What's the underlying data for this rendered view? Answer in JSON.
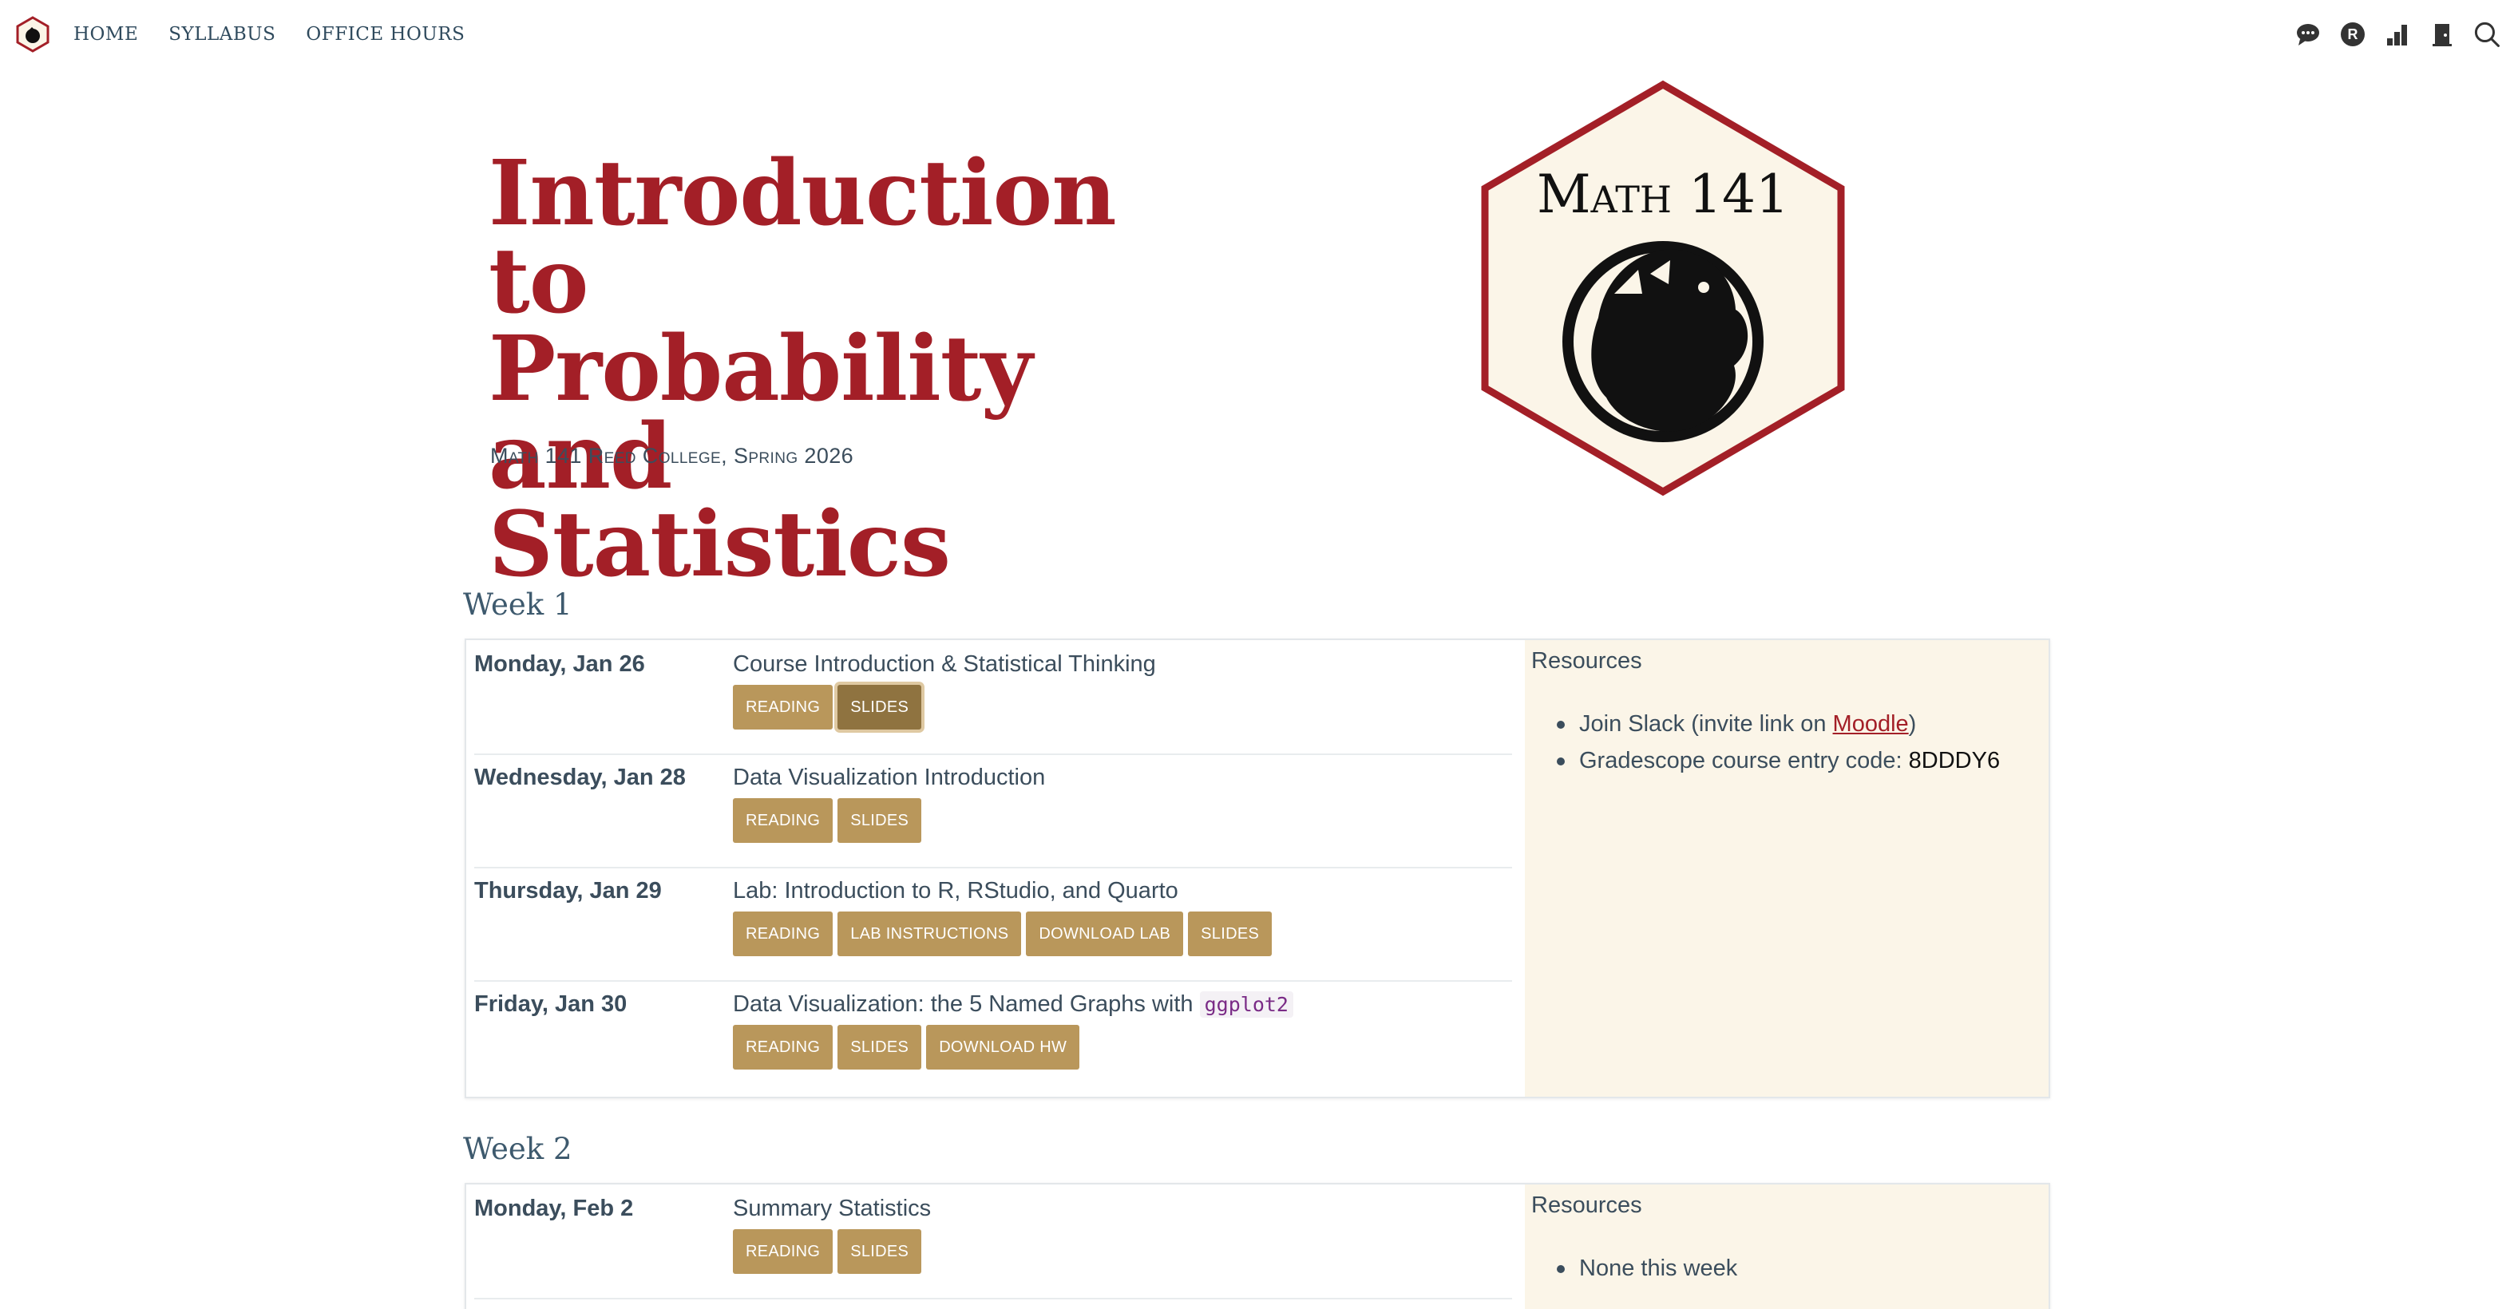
{
  "nav": {
    "logo_icon": "reed-griffin-hex-icon",
    "links": [
      "HOME",
      "SYLLABUS",
      "OFFICE HOURS"
    ],
    "icons": [
      "chat-bubble-icon",
      "r-circle-icon",
      "bar-chart-icon",
      "door-icon",
      "search-icon"
    ]
  },
  "hero": {
    "title_lines": [
      "Introduction to",
      "Probability and",
      "Statistics"
    ],
    "subtitle": "Math 141 Reed College, Spring 2026",
    "logo_text": "Math 141",
    "logo_icon": "griffin-emblem-icon"
  },
  "colors": {
    "accent": "#a31f27",
    "button": "#b9975b",
    "button_active": "#8f7340",
    "resources_bg": "#fbf5e8"
  },
  "weeks": [
    {
      "title": "Week 1",
      "sessions": [
        {
          "date": "Monday, Jan 26",
          "title": "Course Introduction & Statistical Thinking",
          "buttons": [
            "READING",
            "SLIDES"
          ]
        },
        {
          "date": "Wednesday, Jan 28",
          "title": "Data Visualization Introduction",
          "buttons": [
            "READING",
            "SLIDES"
          ]
        },
        {
          "date": "Thursday, Jan 29",
          "title": "Lab: Introduction to R, RStudio, and Quarto",
          "buttons": [
            "READING",
            "LAB INSTRUCTIONS",
            "DOWNLOAD LAB",
            "SLIDES"
          ]
        },
        {
          "date": "Friday, Jan 30",
          "title": "Data Visualization: the 5 Named Graphs with",
          "title_code": "ggplot2",
          "buttons": [
            "READING",
            "SLIDES",
            "DOWNLOAD HW"
          ]
        }
      ],
      "resources": {
        "title": "Resources",
        "items": [
          {
            "prefix": "Join Slack (invite link on ",
            "link": "Moodle",
            "suffix": ")"
          },
          {
            "prefix": "Gradescope course entry code: ",
            "code": "8DDDY6"
          }
        ]
      }
    },
    {
      "title": "Week 2",
      "sessions": [
        {
          "date": "Monday, Feb 2",
          "title": "Summary Statistics",
          "buttons": [
            "READING",
            "SLIDES"
          ]
        }
      ],
      "resources": {
        "title": "Resources",
        "items": [
          {
            "prefix": "None this week"
          }
        ]
      }
    }
  ]
}
